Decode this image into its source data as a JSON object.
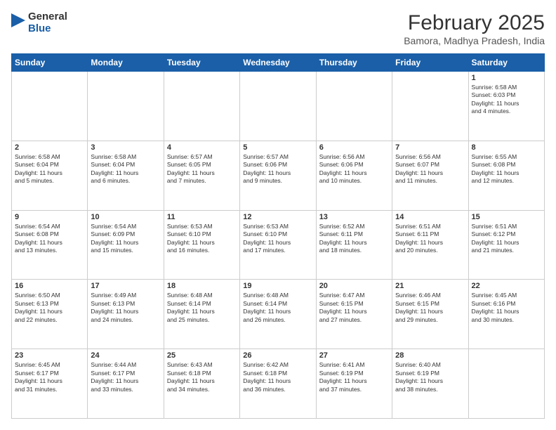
{
  "header": {
    "logo_line1": "General",
    "logo_line2": "Blue",
    "month_year": "February 2025",
    "location": "Bamora, Madhya Pradesh, India"
  },
  "days_of_week": [
    "Sunday",
    "Monday",
    "Tuesday",
    "Wednesday",
    "Thursday",
    "Friday",
    "Saturday"
  ],
  "weeks": [
    [
      {
        "day": "",
        "info": ""
      },
      {
        "day": "",
        "info": ""
      },
      {
        "day": "",
        "info": ""
      },
      {
        "day": "",
        "info": ""
      },
      {
        "day": "",
        "info": ""
      },
      {
        "day": "",
        "info": ""
      },
      {
        "day": "1",
        "info": "Sunrise: 6:58 AM\nSunset: 6:03 PM\nDaylight: 11 hours\nand 4 minutes."
      }
    ],
    [
      {
        "day": "2",
        "info": "Sunrise: 6:58 AM\nSunset: 6:04 PM\nDaylight: 11 hours\nand 5 minutes."
      },
      {
        "day": "3",
        "info": "Sunrise: 6:58 AM\nSunset: 6:04 PM\nDaylight: 11 hours\nand 6 minutes."
      },
      {
        "day": "4",
        "info": "Sunrise: 6:57 AM\nSunset: 6:05 PM\nDaylight: 11 hours\nand 7 minutes."
      },
      {
        "day": "5",
        "info": "Sunrise: 6:57 AM\nSunset: 6:06 PM\nDaylight: 11 hours\nand 9 minutes."
      },
      {
        "day": "6",
        "info": "Sunrise: 6:56 AM\nSunset: 6:06 PM\nDaylight: 11 hours\nand 10 minutes."
      },
      {
        "day": "7",
        "info": "Sunrise: 6:56 AM\nSunset: 6:07 PM\nDaylight: 11 hours\nand 11 minutes."
      },
      {
        "day": "8",
        "info": "Sunrise: 6:55 AM\nSunset: 6:08 PM\nDaylight: 11 hours\nand 12 minutes."
      }
    ],
    [
      {
        "day": "9",
        "info": "Sunrise: 6:54 AM\nSunset: 6:08 PM\nDaylight: 11 hours\nand 13 minutes."
      },
      {
        "day": "10",
        "info": "Sunrise: 6:54 AM\nSunset: 6:09 PM\nDaylight: 11 hours\nand 15 minutes."
      },
      {
        "day": "11",
        "info": "Sunrise: 6:53 AM\nSunset: 6:10 PM\nDaylight: 11 hours\nand 16 minutes."
      },
      {
        "day": "12",
        "info": "Sunrise: 6:53 AM\nSunset: 6:10 PM\nDaylight: 11 hours\nand 17 minutes."
      },
      {
        "day": "13",
        "info": "Sunrise: 6:52 AM\nSunset: 6:11 PM\nDaylight: 11 hours\nand 18 minutes."
      },
      {
        "day": "14",
        "info": "Sunrise: 6:51 AM\nSunset: 6:11 PM\nDaylight: 11 hours\nand 20 minutes."
      },
      {
        "day": "15",
        "info": "Sunrise: 6:51 AM\nSunset: 6:12 PM\nDaylight: 11 hours\nand 21 minutes."
      }
    ],
    [
      {
        "day": "16",
        "info": "Sunrise: 6:50 AM\nSunset: 6:13 PM\nDaylight: 11 hours\nand 22 minutes."
      },
      {
        "day": "17",
        "info": "Sunrise: 6:49 AM\nSunset: 6:13 PM\nDaylight: 11 hours\nand 24 minutes."
      },
      {
        "day": "18",
        "info": "Sunrise: 6:48 AM\nSunset: 6:14 PM\nDaylight: 11 hours\nand 25 minutes."
      },
      {
        "day": "19",
        "info": "Sunrise: 6:48 AM\nSunset: 6:14 PM\nDaylight: 11 hours\nand 26 minutes."
      },
      {
        "day": "20",
        "info": "Sunrise: 6:47 AM\nSunset: 6:15 PM\nDaylight: 11 hours\nand 27 minutes."
      },
      {
        "day": "21",
        "info": "Sunrise: 6:46 AM\nSunset: 6:15 PM\nDaylight: 11 hours\nand 29 minutes."
      },
      {
        "day": "22",
        "info": "Sunrise: 6:45 AM\nSunset: 6:16 PM\nDaylight: 11 hours\nand 30 minutes."
      }
    ],
    [
      {
        "day": "23",
        "info": "Sunrise: 6:45 AM\nSunset: 6:17 PM\nDaylight: 11 hours\nand 31 minutes."
      },
      {
        "day": "24",
        "info": "Sunrise: 6:44 AM\nSunset: 6:17 PM\nDaylight: 11 hours\nand 33 minutes."
      },
      {
        "day": "25",
        "info": "Sunrise: 6:43 AM\nSunset: 6:18 PM\nDaylight: 11 hours\nand 34 minutes."
      },
      {
        "day": "26",
        "info": "Sunrise: 6:42 AM\nSunset: 6:18 PM\nDaylight: 11 hours\nand 36 minutes."
      },
      {
        "day": "27",
        "info": "Sunrise: 6:41 AM\nSunset: 6:19 PM\nDaylight: 11 hours\nand 37 minutes."
      },
      {
        "day": "28",
        "info": "Sunrise: 6:40 AM\nSunset: 6:19 PM\nDaylight: 11 hours\nand 38 minutes."
      },
      {
        "day": "",
        "info": ""
      }
    ]
  ]
}
